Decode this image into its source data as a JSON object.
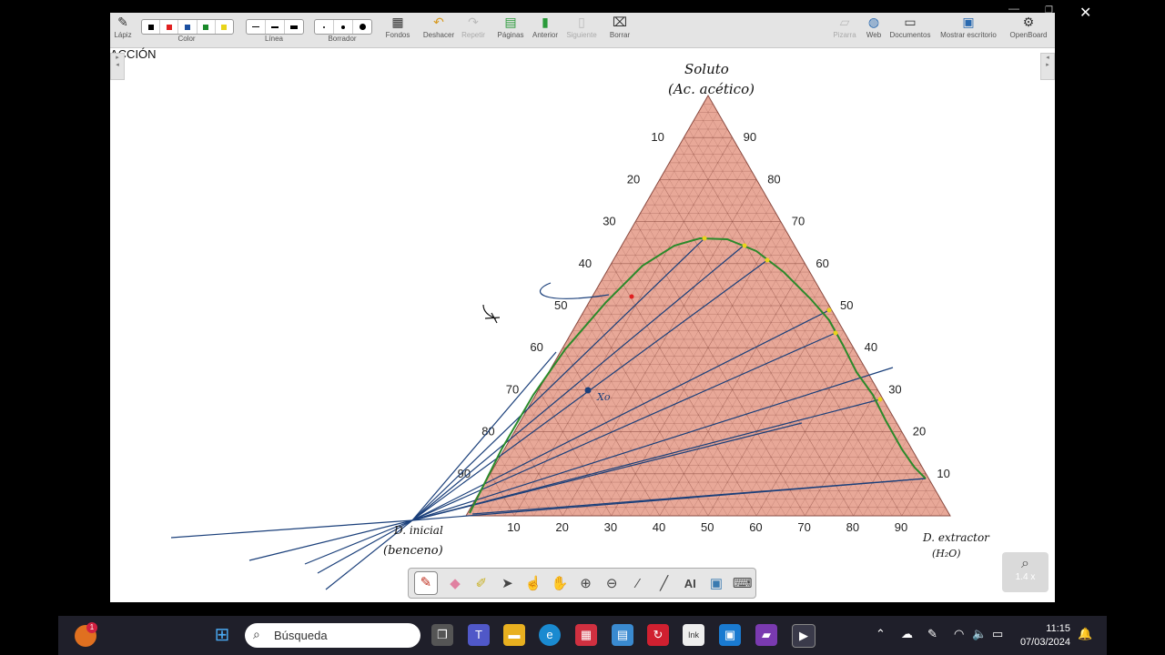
{
  "toolbar": {
    "lapiz": "Lápiz",
    "color": "Color",
    "linea": "Línea",
    "borrador": "Borrador",
    "fondos": "Fondos",
    "deshacer": "Deshacer",
    "repetir": "Repetir",
    "paginas": "Páginas",
    "anterior": "Anterior",
    "siguiente": "Siguiente",
    "borrar": "Borrar",
    "pizarra": "Pizarra",
    "web": "Web",
    "documentos": "Documentos",
    "mostrar_escritorio": "Mostrar escritorio",
    "openboard": "OpenBoard",
    "colors": [
      "#000000",
      "#e02020",
      "#1a4fa0",
      "#1a8a2a",
      "#e8d41a"
    ]
  },
  "page_heading": "ACCIÓN",
  "diagram": {
    "apex_label_1": "Soluto",
    "apex_label_2": "(Ac. acético)",
    "left_label_1": "D. inicial",
    "left_label_2": "(benceno)",
    "right_label_1": "D. extractor",
    "right_label_2": "(H₂O)",
    "point_label": "Xo",
    "left_ticks": [
      "10",
      "20",
      "30",
      "40",
      "50",
      "60",
      "70",
      "80",
      "90"
    ],
    "right_ticks": [
      "90",
      "80",
      "70",
      "60",
      "50",
      "40",
      "30",
      "20",
      "10"
    ],
    "bottom_ticks": [
      "10",
      "20",
      "30",
      "40",
      "50",
      "60",
      "70",
      "80",
      "90"
    ],
    "colors": {
      "fill": "#e8a898",
      "grid": "#7a3a30",
      "tie_line": "#1a3f7a",
      "binodal": "#2a8a2a"
    }
  },
  "zoom": "1.4 x",
  "search": {
    "placeholder": "Búsqueda"
  },
  "clock": {
    "time": "11:15",
    "date": "07/03/2024"
  },
  "notification_badge": "1"
}
